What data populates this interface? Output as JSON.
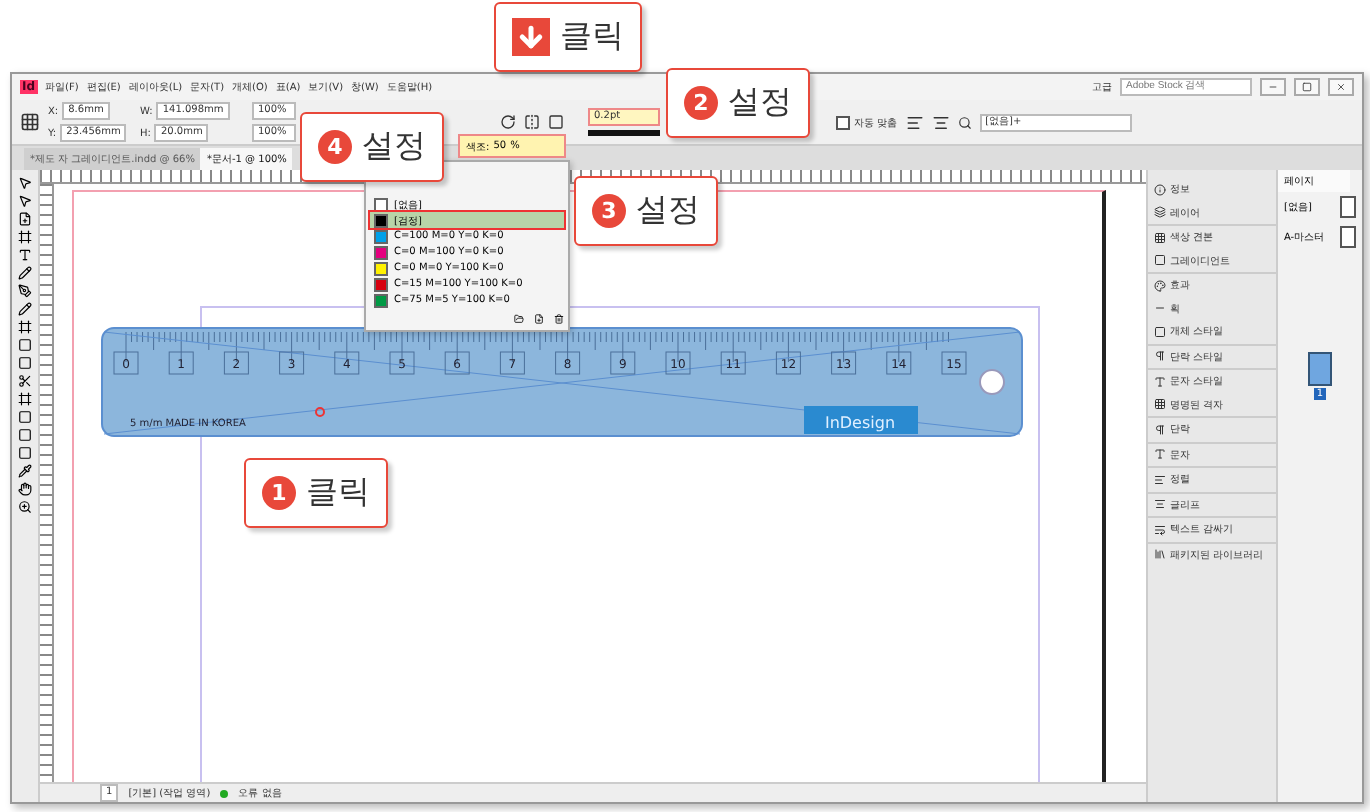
{
  "menu_bar": {
    "app_icon": "Id",
    "items": [
      "파일(F)",
      "편집(E)",
      "레이아웃(L)",
      "문자(T)",
      "개체(O)",
      "표(A)",
      "보기(V)",
      "창(W)",
      "도움말(H)"
    ]
  },
  "workspace": "고급",
  "search": {
    "placeholder": "Adobe Stock 검색"
  },
  "control_panel": {
    "position": [
      {
        "label": "X:",
        "value": "8.6mm"
      },
      {
        "label": "Y:",
        "value": "23.456mm"
      }
    ],
    "size": [
      {
        "label": "W:",
        "value": "141.098mm"
      },
      {
        "label": "H:",
        "value": "20.0mm"
      }
    ],
    "scale": [
      "100%",
      "100%"
    ],
    "stroke_weight": "0.2pt",
    "auto_fit": {
      "label": "자동 맞춤",
      "checked": false
    },
    "style": "[없음]+"
  },
  "tabs": [
    {
      "label": "*제도 자 그레이디언트.indd @ 66%",
      "selected": false
    },
    {
      "label": "*문서-1 @ 100%",
      "selected": true
    }
  ],
  "tint": {
    "label": "색조:",
    "value": "50",
    "unit": "%"
  },
  "swatches": [
    {
      "name": "[없음]",
      "color": "#ffffff",
      "selected": false
    },
    {
      "name": "[검정]",
      "color": "#000000",
      "selected": true
    },
    {
      "name": "C=100 M=0 Y=0 K=0",
      "color": "#00a0e9",
      "selected": false
    },
    {
      "name": "C=0 M=100 Y=0 K=0",
      "color": "#e4007f",
      "selected": false
    },
    {
      "name": "C=0 M=0 Y=100 K=0",
      "color": "#fff100",
      "selected": false
    },
    {
      "name": "C=15 M=100 Y=100 K=0",
      "color": "#d7000f",
      "selected": false
    },
    {
      "name": "C=75 M=5 Y=100 K=0",
      "color": "#009944",
      "selected": false
    }
  ],
  "panels": [
    "정보",
    "레이어",
    "색상 견본",
    "그레이디언트",
    "효과",
    "획",
    "개체 스타일",
    "단락 스타일",
    "문자 스타일",
    "명명된 격자",
    "단락",
    "문자",
    "정렬",
    "글리프",
    "텍스트 감싸기",
    "패키지된 라이브러리"
  ],
  "pages_panel": {
    "title": "페이지",
    "items": [
      "[없음]",
      "A-마스터"
    ],
    "page_number": "1"
  },
  "ruler": {
    "numbers": [
      "0",
      "1",
      "2",
      "3",
      "4",
      "5",
      "6",
      "7",
      "8",
      "9",
      "10",
      "11",
      "12",
      "13",
      "14",
      "15"
    ],
    "caption": "5 m/m MADE IN KOREA",
    "brand": "InDesign"
  },
  "status_bar": {
    "page": "1",
    "preflight_profile": "[기본] (작업 영역)",
    "errors": "오류 없음"
  },
  "callouts": [
    {
      "kind": "arrow",
      "text": "클릭"
    },
    {
      "kind": "number",
      "number": "2",
      "text": "설정"
    },
    {
      "kind": "number",
      "number": "4",
      "text": "설정"
    },
    {
      "kind": "number",
      "number": "3",
      "text": "설정"
    },
    {
      "kind": "number",
      "number": "1",
      "text": "클릭"
    }
  ]
}
